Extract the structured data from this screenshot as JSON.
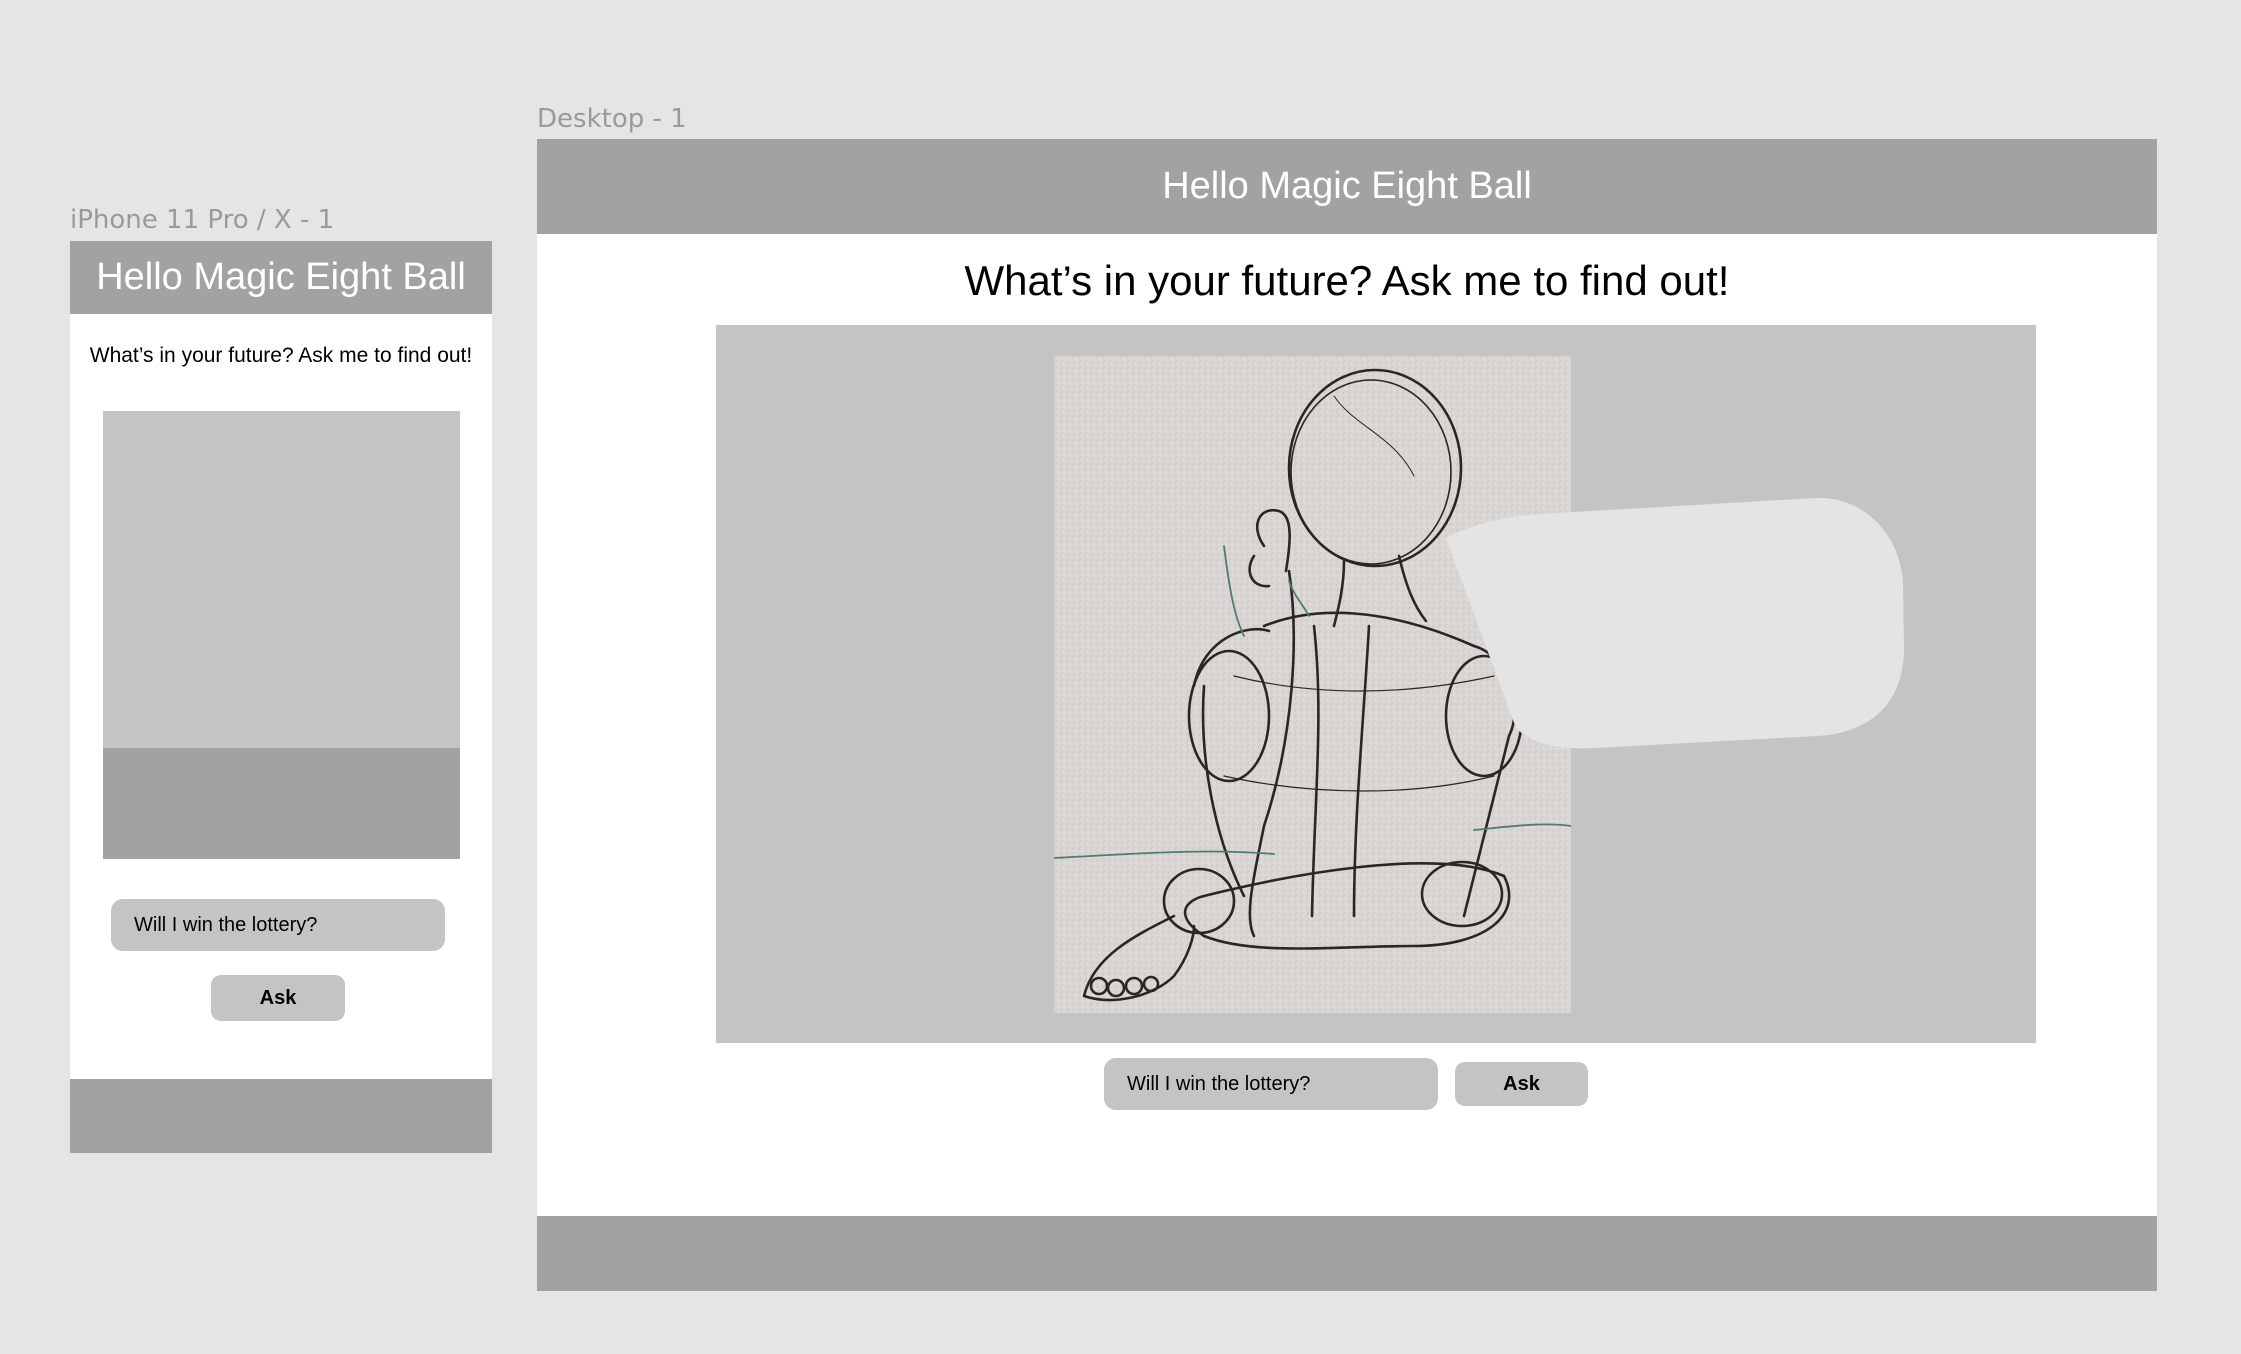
{
  "phone": {
    "frame_label": "iPhone 11 Pro / X - 1",
    "header_title": "Hello Magic Eight Ball",
    "tagline": "What’s in your future? Ask me to find out!",
    "question_value": "Will I win the lottery?",
    "ask_label": "Ask"
  },
  "desktop": {
    "frame_label": "Desktop - 1",
    "header_title": "Hello Magic Eight Ball",
    "tagline": "What’s in your future? Ask me to find out!",
    "question_value": "Will I win the lottery?",
    "ask_label": "Ask",
    "image": "pencil-sketch-figure",
    "overlay": "speech-bubble"
  },
  "colors": {
    "canvas": "#e5e5e5",
    "bar": "#a4a1a1",
    "placeholder": "#c4c4c4",
    "bubble": "#e5e4e5"
  }
}
